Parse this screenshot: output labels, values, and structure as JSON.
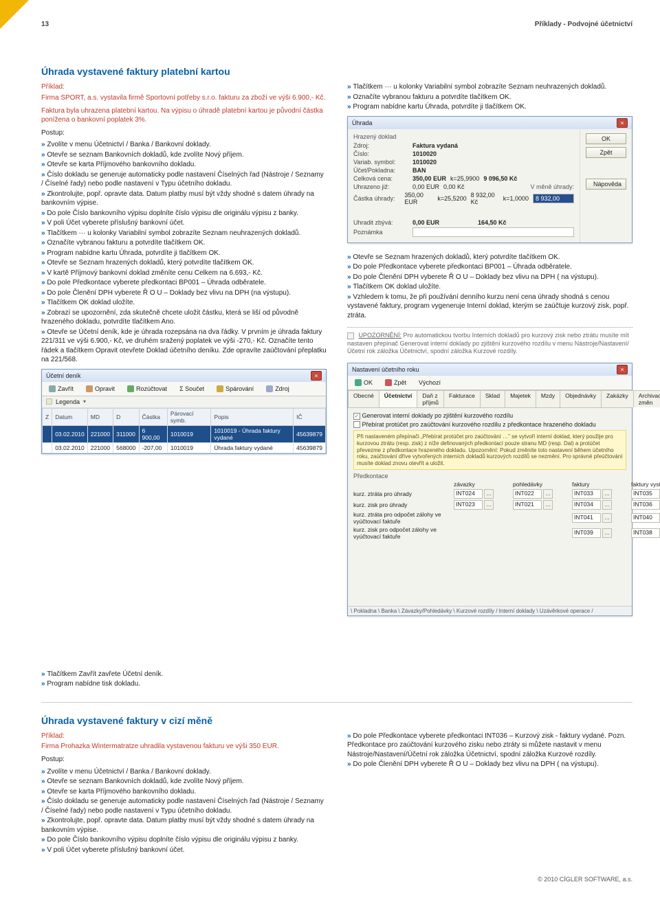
{
  "header": {
    "page_no": "13",
    "running": "Příklady - Podvojné účetnictví"
  },
  "footer": "© 2010 CÍGLER SOFTWARE, a.s.",
  "sectionA": {
    "title": "Úhrada vystavené faktury platební kartou",
    "example_label": "Příklad:",
    "example": "Firma SPORT, a.s. vystavila firmě Sportovní potřeby s.r.o. fakturu za zboží ve výši 6.900,- Kč.",
    "example2": "Faktura byla uhrazena platební kartou. Na výpisu o úhradě platební kartou je původní částka ponížena o bankovní poplatek 3%.",
    "postup_label": "Postup:",
    "steps_left": [
      "Zvolíte v menu Účetnictví / Banka / Bankovní doklady.",
      "Otevře se seznam Bankovních dokladů, kde zvolíte Nový příjem.",
      "Otevře se karta Příjmového bankovního dokladu.",
      "Číslo dokladu se generuje automaticky podle nastavení Číselných řad (Nástroje / Seznamy / Číselné řady) nebo podle nastavení v Typu účetního dokladu.",
      "Zkontrolujte, popř. opravte data. Datum platby musí být vždy shodné s datem úhrady na bankovním výpise.",
      "Do pole Číslo bankovního výpisu doplníte číslo výpisu dle originálu výpisu z banky.",
      "V poli Účet vyberete příslušný bankovní účet.",
      "Tlačítkem ··· u kolonky Variabilní symbol zobrazíte Seznam neuhrazených dokladů.",
      "Označíte vybranou fakturu a potvrdíte tlačítkem OK.",
      "Program nabídne kartu Úhrada, potvrdíte ji tlačítkem OK.",
      "Otevře se Seznam hrazených dokladů, který potvrdíte tlačítkem OK.",
      "V kartě Příjmový bankovní doklad změníte cenu Celkem na 6.693,- Kč.",
      "Do pole Předkontace vyberete předkontaci BP001 – Úhrada odběratele.",
      "Do pole Členění DPH vyberete Ř O U – Doklady bez vlivu na DPH (na výstupu).",
      "Tlačítkem OK doklad uložíte.",
      "Zobrazí se upozornění, zda skutečně chcete uložit částku, která se liší od původně hrazeného dokladu, potvrdíte tlačítkem Ano.",
      "Otevře se Účetní deník, kde je úhrada rozepsána na dva řádky. V prvním je úhrada faktury 221/311 ve výši 6.900,- Kč, ve druhém sražený poplatek ve výši -270,- Kč. Označíte tento řádek a tlačítkem Opravit otevřete Doklad účetního deníku. Zde opravíte zaúčtování přeplatku na 221/568."
    ],
    "steps_right_top": [
      "Tlačítkem ··· u kolonky Variabilní symbol zobrazíte Seznam neuhrazených dokladů.",
      "Označíte vybranou fakturu a potvrdíte tlačítkem OK.",
      "Program nabídne kartu Úhrada, potvrdíte ji tlačítkem OK."
    ],
    "steps_right_mid": [
      "Otevře se Seznam hrazených dokladů, který potvrdíte tlačítkem OK.",
      "Do pole Předkontace vyberete předkontaci BP001 – Úhrada odběratele.",
      "Do pole Členění DPH vyberete Ř O U – Doklady bez vlivu na DPH ( na výstupu).",
      "Tlačítkem OK doklad uložíte.",
      "Vzhledem k tomu, že při používání denního kurzu není cena úhrady shodná s cenou vystavené faktury, program vygeneruje Interní doklad, kterým se zaúčtuje kurzový zisk, popř. ztráta."
    ],
    "upoz_label": "UPOZORNĚNÍ:",
    "upoz": "Pro automatickou tvorbu Interních dokladů pro kurzový zisk nebo ztrátu musíte mít nastaven přepínač Generovat interní doklady po zjištění kurzového rozdílu v menu Nástroje/Nastavení/Účetní rok záložka Účetnictví, spodní záložka Kurzové rozdíly.",
    "after_left": [
      "Tlačítkem Zavřít zavřete Účetní deník.",
      "Program nabídne tisk dokladu."
    ]
  },
  "denik_window": {
    "title": "Účetní deník",
    "toolbar": [
      "Zavřít",
      "Opravit",
      "Rozúčtovat",
      "Σ Součet",
      "Spárování",
      "Zdroj"
    ],
    "legend": "Legenda",
    "cols": [
      "Z",
      "Datum",
      "MD",
      "D",
      "Částka",
      "Párovací symb.",
      "Popis",
      "IČ"
    ],
    "rows": [
      [
        "",
        "03.02.2010",
        "221000",
        "311000",
        "6 900,00",
        "1010019",
        "1010019 - Úhrada faktury vydané",
        "45639879"
      ],
      [
        "",
        "03.02.2010",
        "221000",
        "568000",
        "-207,00",
        "1010019",
        "Úhrada faktury vydané",
        "45639879"
      ]
    ]
  },
  "uhrada_window": {
    "title": "Úhrada",
    "group": "Hrazený doklad",
    "fields": {
      "zdroj_l": "Zdroj:",
      "zdroj_v": "Faktura vydaná",
      "cislo_l": "Číslo:",
      "cislo_v": "1010020",
      "varsym_l": "Variab. symbol:",
      "varsym_v": "1010020",
      "ucet_l": "Účet/Pokladna:",
      "ucet_v": "BAN",
      "celk_l": "Celková cena:",
      "celk_eur": "350,00 EUR",
      "celk_rate": "k=25,9900",
      "celk_kc": "9 096,50 Kč",
      "uhr_l": "Uhrazeno již:",
      "uhr_eur": "0,00 EUR",
      "uhr_kc": "0,00 Kč",
      "vmene": "V měně úhrady:",
      "cast_l": "Částka úhrady:",
      "cast_eur": "350,00 EUR",
      "cast_rate": "k=25,5200",
      "cast_kc": "8 932,00 Kč",
      "cast_rate2": "k=1,0000",
      "cast_sel": "8 932,00",
      "zbyva_l": "Uhradit zbývá:",
      "zbyva_eur": "0,00 EUR",
      "zbyva_kc": "164,50 Kč",
      "pozn_l": "Poznámka"
    },
    "buttons": {
      "ok": "OK",
      "zpet": "Zpět",
      "napoveda": "Nápověda"
    }
  },
  "nastaveni_window": {
    "title": "Nastavení účetního roku",
    "toolbar": [
      "OK",
      "Zpět",
      "Výchozí"
    ],
    "tabs": [
      "Obecné",
      "Účetnictví",
      "Daň z příjmů",
      "Fakturace",
      "Sklad",
      "Majetek",
      "Mzdy",
      "Objednávky",
      "Zakázky",
      "Archivace změn"
    ],
    "cb1": "Generovat interní doklady po zjištění kurzového rozdílu",
    "cb2": "Přebírat protúčet pro zaúčtování kurzového rozdílu z předkontace hrazeného dokladu",
    "note": "Při nastaveném přepínači „Přebírat protúčet pro zaúčtování …\" se vytvoří interní doklad, který použije pro kurzovou ztrátu (resp. zisk) z níže definovaných předkontací pouze stranu MD (resp. Dal) a protúčet převezme z předkontace hrazeného dokladu. Upozornění: Pokud změníte toto nastavení během účetního roku, zaúčtování dříve vytvořených interních dokladů kurzových rozdílů se nezmění. Pro správné přeúčtování musíte doklad znovu otevřít a uložit.",
    "group": "Předkontace",
    "heads": [
      "",
      "závazky",
      "pohledávky",
      "faktury",
      "faktury vyst."
    ],
    "rows": [
      [
        "kurz. ztráta pro úhrady",
        "INT024",
        "INT022",
        "INT033",
        "INT035"
      ],
      [
        "kurz. zisk pro úhrady",
        "INT023",
        "INT021",
        "INT034",
        "INT036"
      ],
      [
        "kurz. ztráta pro odpočet zálohy ve vyúčtovací faktuře",
        "",
        "",
        "INT041",
        "INT040"
      ],
      [
        "kurz. zisk pro odpočet zálohy ve vyúčtovací faktuře",
        "",
        "",
        "INT039",
        "INT038"
      ]
    ],
    "status": "\\ Pokladna \\ Banka \\ Závazky/Pohledávky \\ Kurzové rozdíly / Interní doklady \\ Uzávěrkové operace /"
  },
  "sectionB": {
    "title": "Úhrada vystavené faktury v cizí měně",
    "example_label": "Příklad:",
    "example": "Firma Prohazka Wintermatratze uhradila vystavenou fakturu ve výši 350 EUR.",
    "postup_label": "Postup:",
    "steps_left": [
      "Zvolíte v menu Účetnictví / Banka / Bankovní doklady.",
      "Otevře se seznam Bankovních dokladů, kde zvolíte Nový příjem.",
      "Otevře se karta Příjmového bankovního dokladu.",
      "Číslo dokladu se generuje automaticky podle nastavení Číselných řad (Nástroje / Seznamy / Číselné řady) nebo podle nastavení v Typu účetního dokladu.",
      "Zkontrolujte, popř. opravte data. Datum platby musí být vždy shodné s datem úhrady na bankovním výpise.",
      "Do pole Číslo bankovního výpisu doplníte číslo výpisu dle originálu výpisu z banky.",
      "V poli Účet vyberete příslušný bankovní účet."
    ],
    "steps_right": [
      "Do pole Předkontace vyberete předkontaci INT036 – Kurzový zisk - faktury vydané. Pozn. Předkontace pro zaúčtování kurzového zisku nebo ztráty si můžete nastavit v menu Nástroje/Nastavení/Účetní rok záložka Účetnictví, spodní záložka Kurzové rozdíly.",
      "Do pole Členění DPH vyberete Ř O U – Doklady bez vlivu na DPH ( na výstupu)."
    ]
  }
}
